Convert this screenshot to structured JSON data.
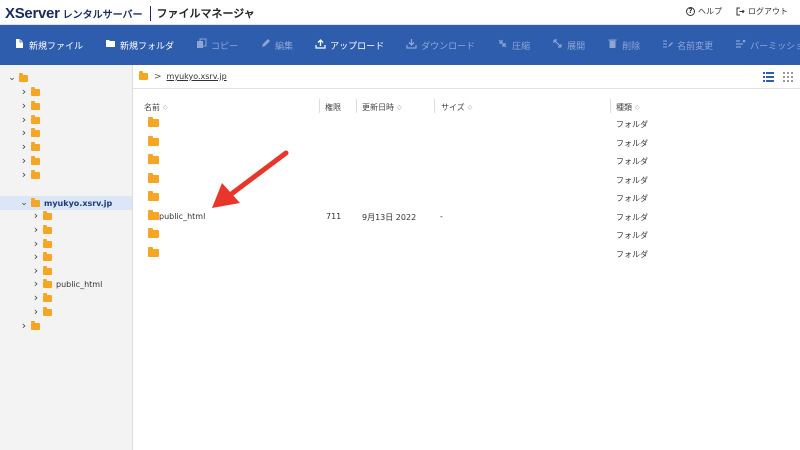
{
  "header": {
    "brand_name": "XServer",
    "brand_sub": "レンタルサーバー",
    "app_title": "ファイルマネージャ",
    "help_label": "ヘルプ",
    "logout_label": "ログアウト"
  },
  "toolbar": {
    "items": [
      {
        "label": "新規ファイル",
        "icon": "new-file-icon",
        "enabled": true
      },
      {
        "label": "新規フォルダ",
        "icon": "new-folder-icon",
        "enabled": true
      },
      {
        "label": "コピー",
        "icon": "copy-icon",
        "enabled": false
      },
      {
        "label": "編集",
        "icon": "pencil-icon",
        "enabled": false
      },
      {
        "label": "アップロード",
        "icon": "upload-icon",
        "enabled": true
      },
      {
        "label": "ダウンロード",
        "icon": "download-icon",
        "enabled": false
      },
      {
        "label": "圧縮",
        "icon": "compress-icon",
        "enabled": false
      },
      {
        "label": "展開",
        "icon": "expand-icon",
        "enabled": false
      },
      {
        "label": "削除",
        "icon": "trash-icon",
        "enabled": false
      },
      {
        "label": "名前変更",
        "icon": "rename-icon",
        "enabled": false
      },
      {
        "label": "パーミッション変更",
        "icon": "permission-icon",
        "enabled": false
      }
    ]
  },
  "sidebar": {
    "tree": [
      {
        "label": "",
        "expanded": true,
        "selected": false
      },
      {
        "label": "",
        "expanded": false,
        "selected": false
      },
      {
        "label": "",
        "expanded": false,
        "selected": false
      },
      {
        "label": "",
        "expanded": false,
        "selected": false
      },
      {
        "label": "",
        "expanded": false,
        "selected": false
      },
      {
        "label": "",
        "expanded": false,
        "selected": false
      },
      {
        "label": "",
        "expanded": false,
        "selected": false
      },
      {
        "label": "",
        "expanded": false,
        "selected": false
      },
      {
        "label": "myukyo.xsrv.jp",
        "expanded": true,
        "selected": true
      },
      {
        "label": "",
        "expanded": false,
        "selected": false
      },
      {
        "label": "",
        "expanded": false,
        "selected": false
      },
      {
        "label": "",
        "expanded": false,
        "selected": false
      },
      {
        "label": "",
        "expanded": false,
        "selected": false
      },
      {
        "label": "",
        "expanded": false,
        "selected": false
      },
      {
        "label": "public_html",
        "expanded": false,
        "selected": false
      },
      {
        "label": "",
        "expanded": false,
        "selected": false
      },
      {
        "label": "",
        "expanded": false,
        "selected": false
      },
      {
        "label": "",
        "expanded": false,
        "selected": false
      }
    ]
  },
  "main": {
    "path": "myukyo.xsrv.jp",
    "columns": {
      "name": "名前",
      "perm": "権限",
      "date": "更新日時",
      "size": "サイズ",
      "kind": "種類"
    },
    "rows": [
      {
        "name": "",
        "perm": "",
        "date": "",
        "size": "",
        "kind": "フォルダ"
      },
      {
        "name": "",
        "perm": "",
        "date": "",
        "size": "",
        "kind": "フォルダ"
      },
      {
        "name": "",
        "perm": "",
        "date": "",
        "size": "",
        "kind": "フォルダ"
      },
      {
        "name": "",
        "perm": "",
        "date": "",
        "size": "",
        "kind": "フォルダ"
      },
      {
        "name": "",
        "perm": "",
        "date": "",
        "size": "",
        "kind": "フォルダ"
      },
      {
        "name": "public_html",
        "perm": "711",
        "date": "9月13日 2022",
        "size": "-",
        "kind": "フォルダ"
      },
      {
        "name": "",
        "perm": "",
        "date": "",
        "size": "",
        "kind": "フォルダ"
      },
      {
        "name": "",
        "perm": "",
        "date": "",
        "size": "",
        "kind": "フォルダ"
      }
    ]
  },
  "colors": {
    "toolbar_bg": "#2e5dad",
    "folder": "#f5a623",
    "selected_bg": "#dbe6f6",
    "annotation_arrow": "#e8372a"
  }
}
